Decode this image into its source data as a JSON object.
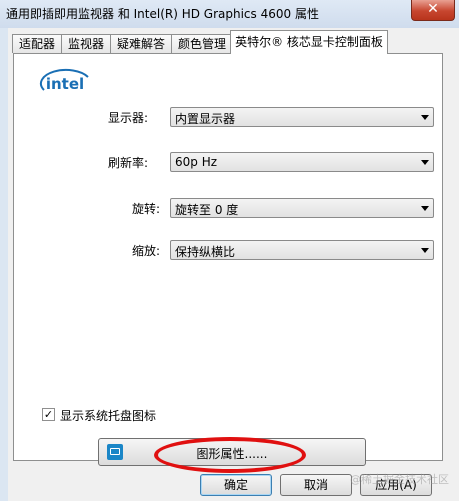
{
  "window": {
    "title": "通用即插即用监视器 和 Intel(R) HD Graphics 4600 属性",
    "close_glyph": "✕"
  },
  "tabs": [
    {
      "label": "适配器",
      "active": false
    },
    {
      "label": "监视器",
      "active": false
    },
    {
      "label": "疑难解答",
      "active": false
    },
    {
      "label": "颜色管理",
      "active": false
    },
    {
      "label": "英特尔® 核芯显卡控制面板",
      "active": true
    }
  ],
  "panel": {
    "logo_text": "intel",
    "display": {
      "label": "显示器:",
      "value": "内置显示器"
    },
    "refresh": {
      "label": "刷新率:",
      "value": "60p Hz"
    },
    "rotation": {
      "label": "旋转:",
      "value": "旋转至 0 度"
    },
    "scaling": {
      "label": "缩放:",
      "value": "保持纵横比"
    },
    "tray_checkbox": {
      "label": "显示系统托盘图标",
      "checked": true,
      "check_glyph": "✓"
    },
    "graphics_button": {
      "label": "图形属性......",
      "icon": "intel-graphics-icon"
    }
  },
  "buttons": {
    "ok": "确定",
    "cancel": "取消",
    "apply": "应用(A)"
  },
  "watermark": "@稀土掘金技术社区",
  "colors": {
    "annotation_red": "#e01010",
    "intel_blue": "#1a6fb4"
  }
}
